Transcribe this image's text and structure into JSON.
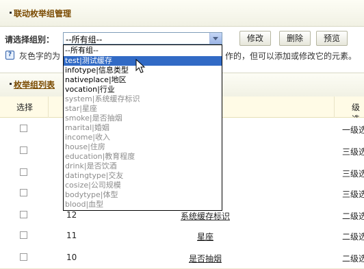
{
  "header": {
    "title": "联动枚举组管理"
  },
  "group_select": {
    "label": "请选择组别：",
    "selected": "--所有组--"
  },
  "buttons": {
    "edit": "修改",
    "delete": "删除",
    "preview": "预览"
  },
  "hint": {
    "text_left": "灰色字的为",
    "text_right": "作的，但可以添加或修改它的元素。"
  },
  "list": {
    "title": "枚举组列表",
    "columns": {
      "select": "选择",
      "level": "级选"
    },
    "rows": [
      {
        "id": "",
        "name": "",
        "level": "一级选"
      },
      {
        "id": "",
        "name": "",
        "level": "三级选"
      },
      {
        "id": "",
        "name": "",
        "level": "三级选"
      },
      {
        "id": "",
        "name": "",
        "level": "三级选"
      },
      {
        "id": "12",
        "name": "系统缓存标识",
        "level": "二级选"
      },
      {
        "id": "11",
        "name": "星座",
        "level": "二级选"
      },
      {
        "id": "10",
        "name": "是否抽烟",
        "level": "二级选"
      }
    ]
  },
  "dropdown": {
    "options": [
      {
        "label": "--所有组--",
        "state": "normal"
      },
      {
        "label": "test|测试缓存",
        "state": "selected"
      },
      {
        "label": "infotype|信息类型",
        "state": "normal"
      },
      {
        "label": "nativeplace|地区",
        "state": "normal"
      },
      {
        "label": "vocation|行业",
        "state": "normal"
      },
      {
        "label": "system|系统缓存标识",
        "state": "gray"
      },
      {
        "label": "star|星座",
        "state": "gray"
      },
      {
        "label": "smoke|是否抽烟",
        "state": "gray"
      },
      {
        "label": "marital|婚姻",
        "state": "gray"
      },
      {
        "label": "income|收入",
        "state": "gray"
      },
      {
        "label": "house|住房",
        "state": "gray"
      },
      {
        "label": "education|教育程度",
        "state": "gray"
      },
      {
        "label": "drink|是否饮酒",
        "state": "gray"
      },
      {
        "label": "datingtype|交友",
        "state": "gray"
      },
      {
        "label": "cosize|公司规模",
        "state": "gray"
      },
      {
        "label": "bodytype|体型",
        "state": "gray"
      },
      {
        "label": "blood|血型",
        "state": "gray"
      }
    ]
  },
  "colors": {
    "selected_bg": "#316ac5",
    "header_text": "#7a4a00",
    "gray_option": "#8c8c8c"
  }
}
